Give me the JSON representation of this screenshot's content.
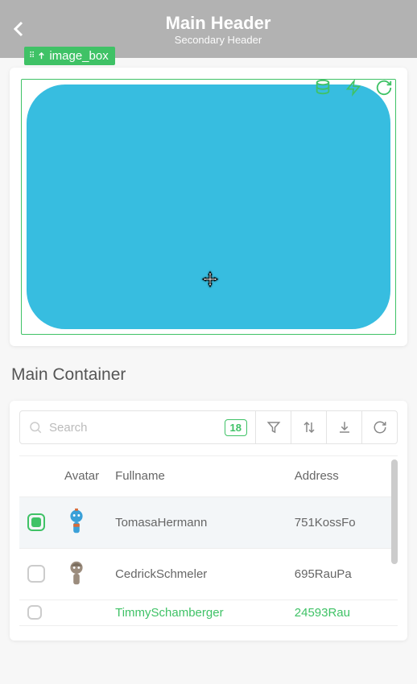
{
  "header": {
    "main": "Main Header",
    "secondary": "Secondary Header"
  },
  "element_label": "image_box",
  "section_title": "Main Container",
  "search": {
    "placeholder": "Search",
    "count": "18"
  },
  "table": {
    "columns": {
      "avatar": "Avatar",
      "fullname": "Fullname",
      "address": "Address"
    },
    "rows": [
      {
        "checked": true,
        "fullname": "TomasaHermann",
        "address": "751KossFo"
      },
      {
        "checked": false,
        "fullname": "CedrickSchmeler",
        "address": "695RauPa"
      },
      {
        "checked": false,
        "fullname": "TimmySchamberger",
        "address": "24593Rau"
      }
    ]
  },
  "icons": {
    "database": "database-icon",
    "lightning": "lightning-icon",
    "refresh": "refresh-icon",
    "filter": "filter-icon",
    "sort": "sort-icon",
    "download": "download-icon",
    "reload": "reload-icon"
  }
}
